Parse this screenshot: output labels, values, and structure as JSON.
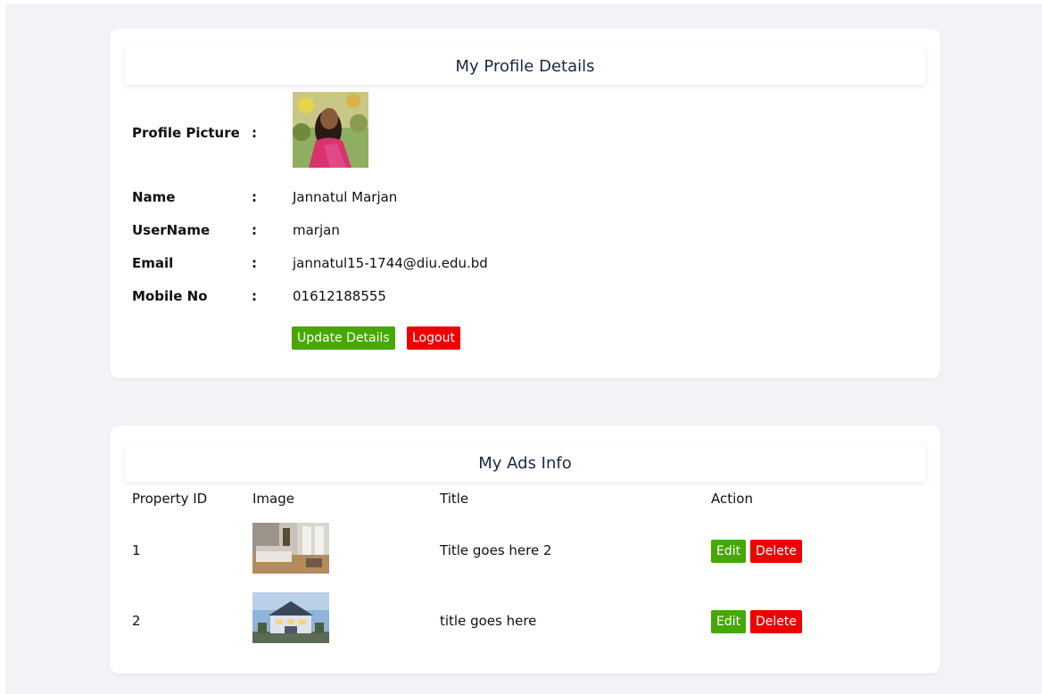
{
  "profile": {
    "title": "My Profile Details",
    "fields": {
      "picture_label": "Profile Picture",
      "name_label": "Name",
      "username_label": "UserName",
      "email_label": "Email",
      "mobile_label": "Mobile No",
      "separator": ":"
    },
    "values": {
      "name": "Jannatul Marjan",
      "username": "marjan",
      "email": "jannatul15-1744@diu.edu.bd",
      "mobile": "01612188555"
    },
    "buttons": {
      "update_label": "Update Details",
      "logout_label": "Logout"
    }
  },
  "ads": {
    "title": "My Ads Info",
    "columns": [
      "Property ID",
      "Image",
      "Title",
      "Action"
    ],
    "rows": [
      {
        "id": "1",
        "title": "Title goes here 2",
        "edit_label": "Edit",
        "delete_label": "Delete",
        "image": "bedroom-photo"
      },
      {
        "id": "2",
        "title": "title goes here",
        "edit_label": "Edit",
        "delete_label": "Delete",
        "image": "house-photo"
      }
    ]
  },
  "colors": {
    "primary_button": "#46a800",
    "danger_button": "#ee0000",
    "heading_text": "#1b2845",
    "page_background": "#f2f3f6"
  }
}
